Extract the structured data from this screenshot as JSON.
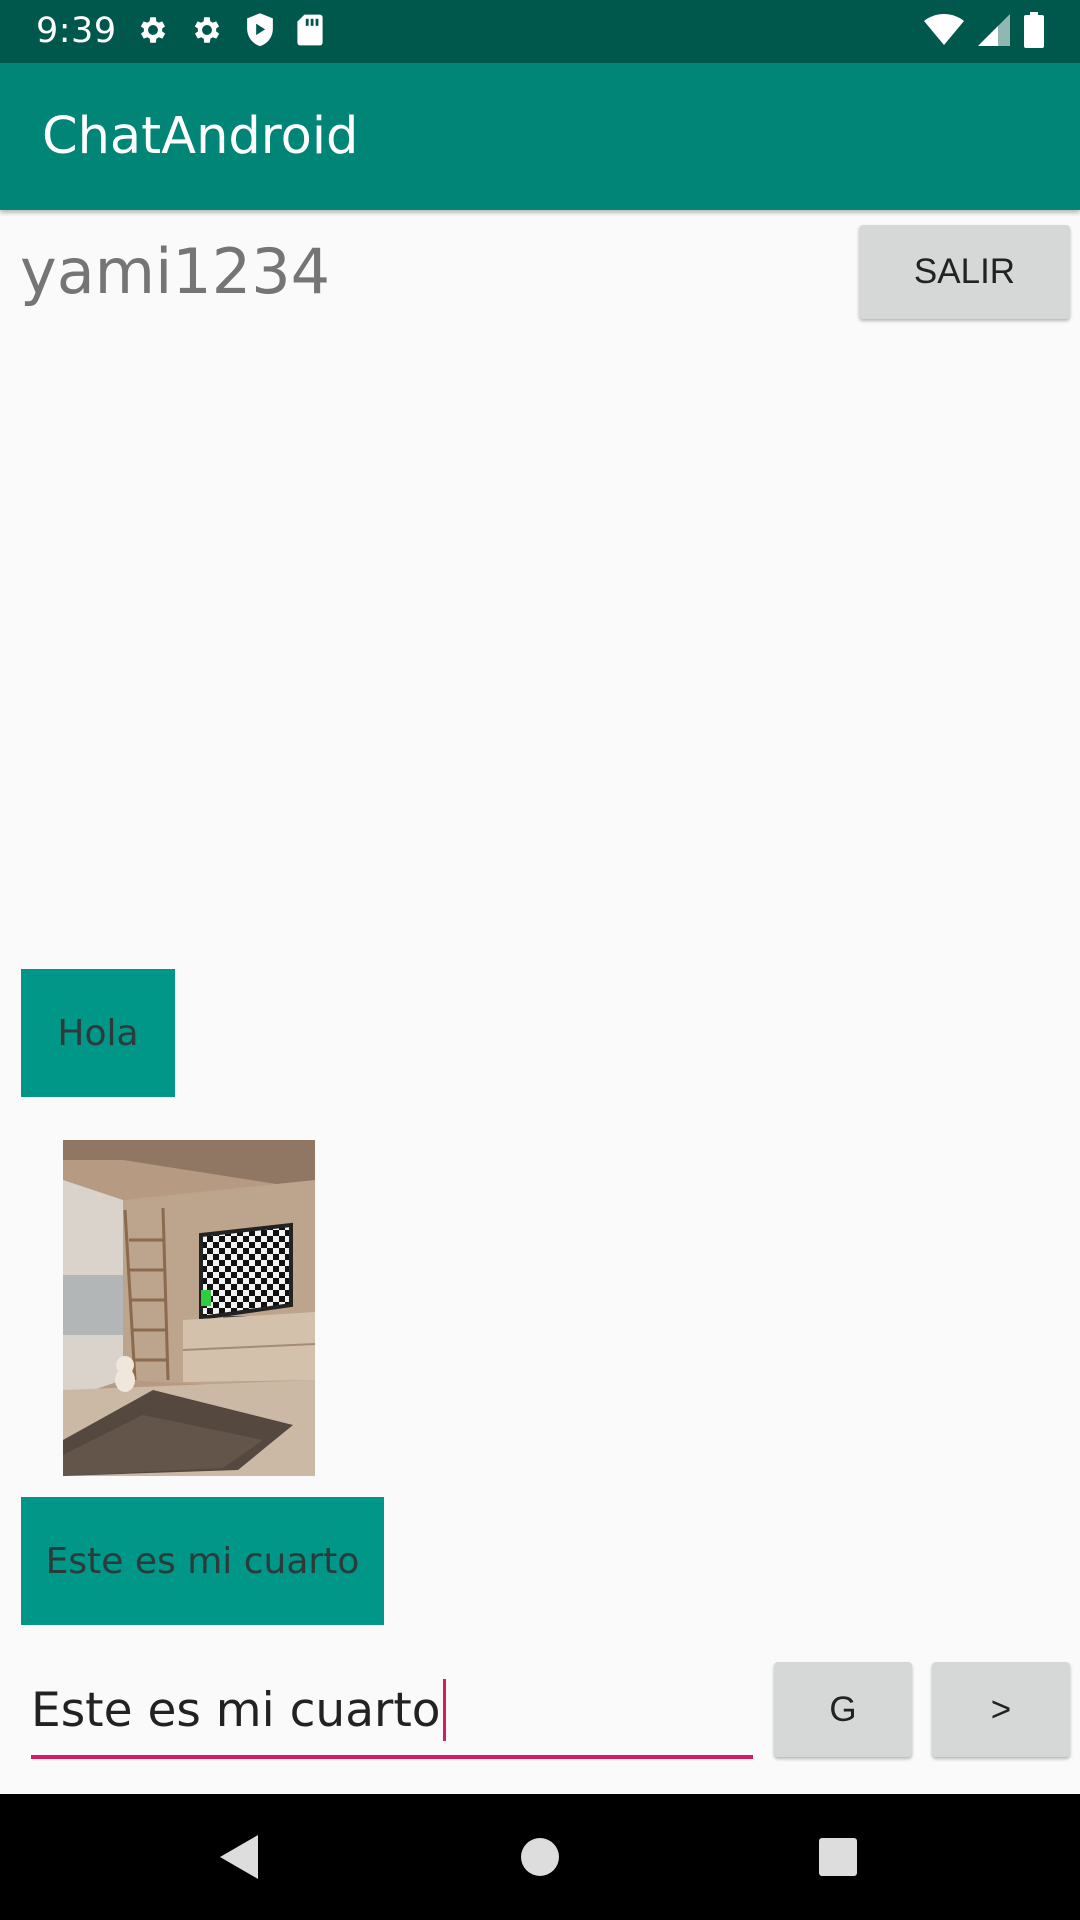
{
  "status_bar": {
    "time": "9:39",
    "icons": [
      "gear-icon",
      "gear-icon",
      "shield-play-icon",
      "sd-card-icon",
      "wifi-icon",
      "signal-icon",
      "battery-icon"
    ]
  },
  "app_bar": {
    "title": "ChatAndroid"
  },
  "header": {
    "username": "yami1234",
    "logout_label": "SALIR"
  },
  "messages": [
    {
      "type": "text",
      "text": "Hola"
    },
    {
      "type": "image"
    },
    {
      "type": "text",
      "text": "Este es mi cuarto"
    }
  ],
  "composer": {
    "input_value": "Este es mi cuarto",
    "g_button_label": "G",
    "send_button_label": ">"
  },
  "nav_bar": {
    "icons": [
      "back-icon",
      "home-icon",
      "recents-icon"
    ]
  },
  "colors": {
    "status_bar": "#00574b",
    "primary": "#008577",
    "bubble": "#009688",
    "accent": "#d81b60"
  }
}
